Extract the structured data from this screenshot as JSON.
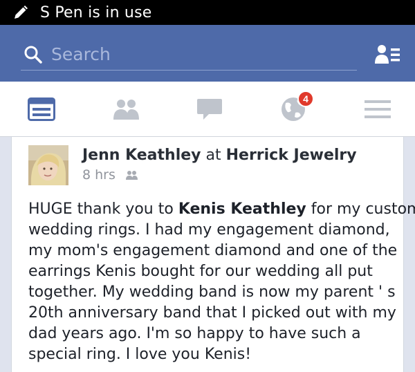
{
  "status_bar": {
    "text": "S Pen is in use"
  },
  "header": {
    "search_placeholder": "Search"
  },
  "tabs": {
    "notifications_badge": "4"
  },
  "post": {
    "author": "Jenn Keathley",
    "at_word": "at",
    "place": "Herrick Jewelry",
    "time": "8 hrs",
    "lines": [
      {
        "pre": "HUGE thank you to ",
        "bold": "Kenis Keathley",
        "post": " for my custom"
      },
      {
        "pre": "wedding rings.  I had my engagement diamond,",
        "bold": "",
        "post": ""
      },
      {
        "pre": "my mom's engagement diamond and one of the",
        "bold": "",
        "post": ""
      },
      {
        "pre": "earrings Kenis bought for our wedding all put",
        "bold": "",
        "post": ""
      },
      {
        "pre": "together.  My wedding band is now my parent ' s",
        "bold": "",
        "post": ""
      },
      {
        "pre": "20th anniversary band that I picked out with my",
        "bold": "",
        "post": ""
      },
      {
        "pre": "dad years ago.  I'm so happy to have such a",
        "bold": "",
        "post": ""
      },
      {
        "pre": "special ring. I love you Kenis!",
        "bold": "",
        "post": ""
      }
    ]
  },
  "colors": {
    "header_bg": "#4e6aa9",
    "tab_active": "#4e6aa9",
    "tab_inactive": "#bfc4cc",
    "badge": "#e0392b"
  },
  "icons": [
    "pen-icon",
    "search-icon",
    "friend-requests-icon",
    "news-feed-icon",
    "friends-icon",
    "messages-icon",
    "globe-notifications-icon",
    "menu-icon",
    "audience-friends-icon"
  ]
}
